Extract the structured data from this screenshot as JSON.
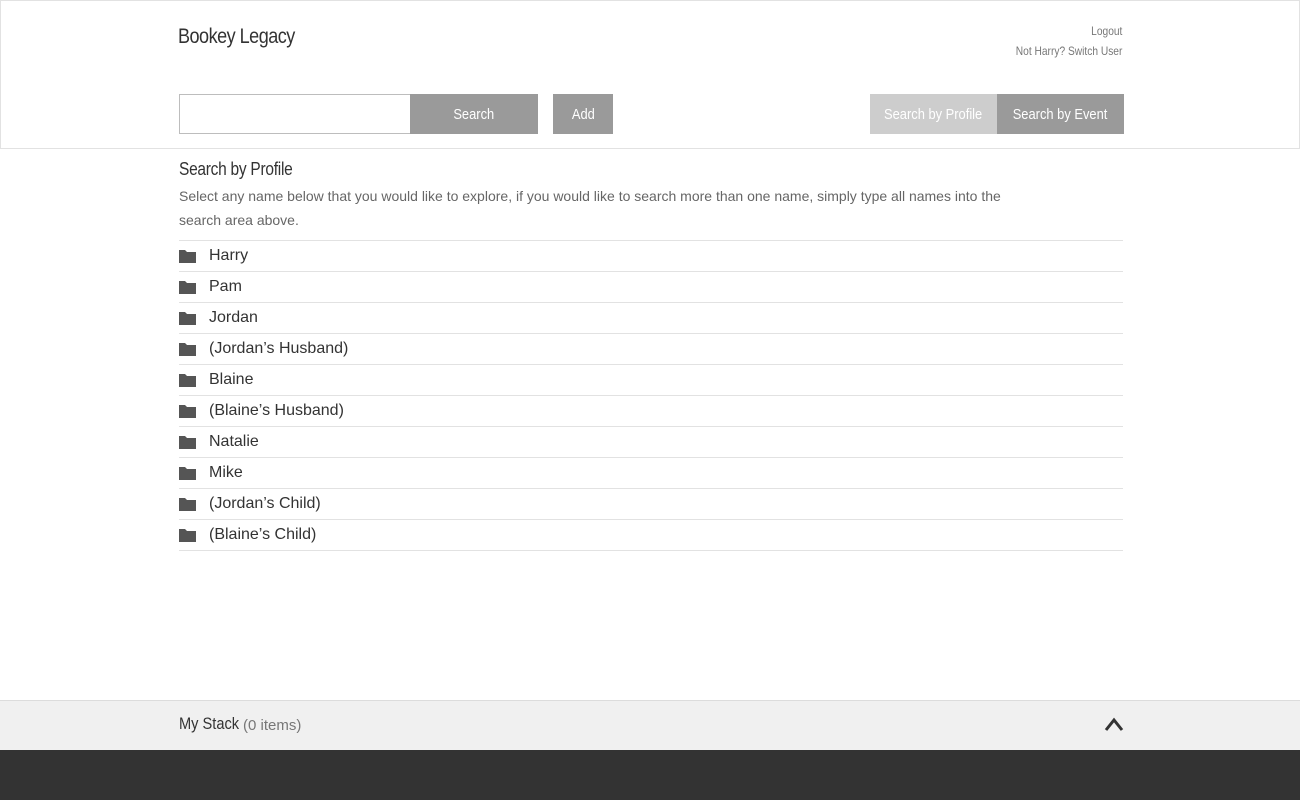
{
  "header": {
    "brand": "Bookey Legacy",
    "logout": "Logout",
    "switch_user": "Not Harry? Switch User"
  },
  "toolbar": {
    "search_value": "",
    "search_label": "Search",
    "add_label": "Add",
    "search_by_profile_label": "Search by Profile",
    "search_by_event_label": "Search by Event"
  },
  "section": {
    "title": "Search by Profile",
    "description": "Select any name below that you would like to explore, if you would like to search more than one name, simply type all names into the search area above."
  },
  "profiles": [
    {
      "name": "Harry",
      "icon": "folder-icon"
    },
    {
      "name": "Pam",
      "icon": "folder-icon"
    },
    {
      "name": "Jordan",
      "icon": "folder-icon"
    },
    {
      "name": "(Jordan’s Husband)",
      "icon": "folder-icon"
    },
    {
      "name": "Blaine",
      "icon": "folder-icon"
    },
    {
      "name": "(Blaine’s Husband)",
      "icon": "folder-icon"
    },
    {
      "name": "Natalie",
      "icon": "folder-icon"
    },
    {
      "name": "Mike",
      "icon": "folder-icon"
    },
    {
      "name": "(Jordan’s Child)",
      "icon": "folder-icon"
    },
    {
      "name": "(Blaine’s Child)",
      "icon": "folder-icon"
    }
  ],
  "stack": {
    "title": "My Stack",
    "count_label": "(0 items)",
    "toggle_icon": "chevron-up-icon"
  },
  "colors": {
    "button_gray": "#9a9a9a",
    "button_light": "#cdcdcd",
    "footer": "#333333",
    "stack_bar": "#f0f0f0"
  }
}
